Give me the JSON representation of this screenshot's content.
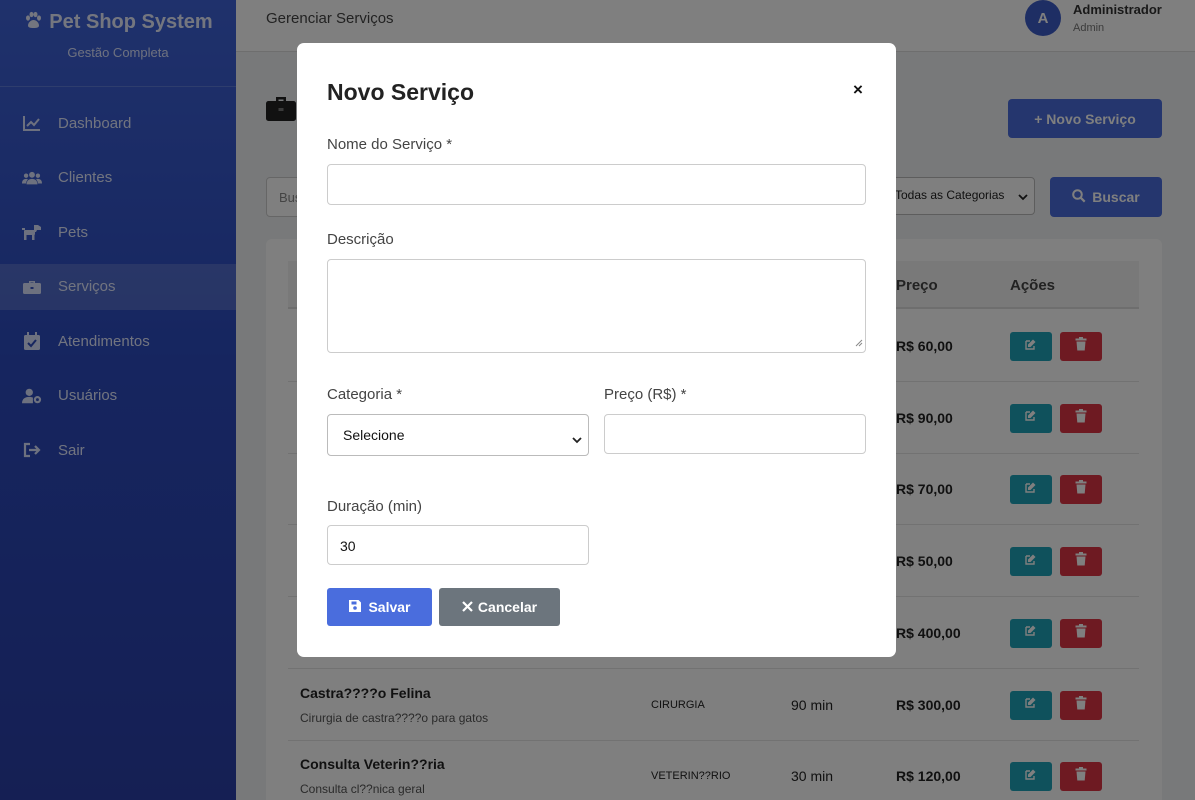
{
  "sidebar": {
    "brand_title": "Pet Shop System",
    "brand_subtitle": "Gestão Completa",
    "items": [
      {
        "label": "Dashboard",
        "icon": "chart-line-icon"
      },
      {
        "label": "Clientes",
        "icon": "users-icon"
      },
      {
        "label": "Pets",
        "icon": "dog-icon"
      },
      {
        "label": "Serviços",
        "icon": "briefcase-icon",
        "active": true
      },
      {
        "label": "Atendimentos",
        "icon": "calendar-check-icon"
      },
      {
        "label": "Usuários",
        "icon": "user-cog-icon"
      },
      {
        "label": "Sair",
        "icon": "sign-out-icon"
      }
    ]
  },
  "topbar": {
    "title": "Gerenciar Serviços",
    "avatar_letter": "A",
    "user_name": "Administrador",
    "user_role": "Admin"
  },
  "page": {
    "new_button": "+ Novo Serviço",
    "search_placeholder": "Bus",
    "category_filter": "Todas as Categorias",
    "search_button": "Buscar"
  },
  "table": {
    "headers": {
      "preco": "Preço",
      "acoes": "Ações"
    },
    "rows": [
      {
        "name": "",
        "desc": "",
        "category": "",
        "duration": "",
        "price": "R$ 60,00"
      },
      {
        "name": "",
        "desc": "",
        "category": "",
        "duration": "",
        "price": "R$ 90,00"
      },
      {
        "name": "",
        "desc": "",
        "category": "",
        "duration": "",
        "price": "R$ 70,00"
      },
      {
        "name": "",
        "desc": "",
        "category": "",
        "duration": "",
        "price": "R$ 50,00"
      },
      {
        "name": "",
        "desc": "",
        "category": "",
        "duration": "",
        "price": "R$ 400,00"
      },
      {
        "name": "Castra????o Felina",
        "desc": "Cirurgia de castra????o para gatos",
        "category": "CIRURGIA",
        "duration": "90 min",
        "price": "R$ 300,00"
      },
      {
        "name": "Consulta Veterin??ria",
        "desc": "Consulta cl??nica geral",
        "category": "VETERIN??RIO",
        "duration": "30 min",
        "price": "R$ 120,00"
      }
    ]
  },
  "modal": {
    "title": "Novo Serviço",
    "close": "×",
    "nome_label": "Nome do Serviço *",
    "nome_value": "",
    "descricao_label": "Descrição",
    "descricao_value": "",
    "categoria_label": "Categoria *",
    "categoria_value": "Selecione",
    "preco_label": "Preço (R$) *",
    "preco_value": "",
    "duracao_label": "Duração (min)",
    "duracao_value": "30",
    "save_button": "Salvar",
    "cancel_button": "Cancelar"
  },
  "colors": {
    "primary": "#4a6ddd",
    "sidebar": "#2c4bbf",
    "edit": "#1fa2b8",
    "delete": "#dc3545",
    "secondary": "#6c757d"
  }
}
